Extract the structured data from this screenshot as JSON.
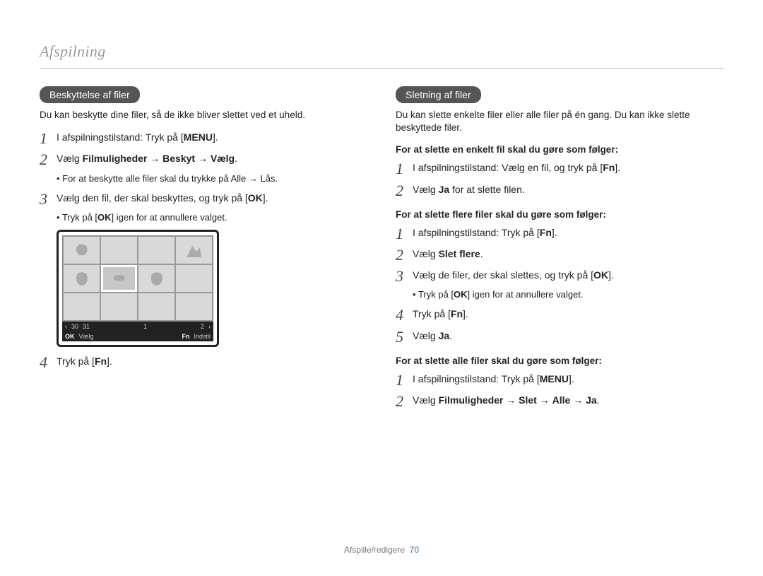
{
  "page": {
    "title": "Afspilning",
    "footer_section": "Afspille/redigere",
    "footer_page": "70"
  },
  "keys": {
    "menu": "MENU",
    "ok": "OK",
    "fn": "Fn"
  },
  "diagram": {
    "dates": {
      "left_arrow": "‹",
      "d1": "30",
      "d2": "31",
      "d3": "1",
      "d4": "2",
      "right_arrow": "›"
    },
    "footer": {
      "ok": "OK",
      "ok_label": "Vælg",
      "fn": "Fn",
      "fn_label": "Indstil"
    }
  },
  "left": {
    "heading": "Beskyttelse af filer",
    "intro": "Du kan beskytte dine filer, så de ikke bliver slettet ved et uheld.",
    "steps": {
      "s1_a": "I afspilningstilstand: Tryk på [",
      "s1_b": "].",
      "s2_a": "Vælg ",
      "s2_b": "Filmuligheder",
      "s2_c": " → ",
      "s2_d": "Beskyt",
      "s2_e": " → ",
      "s2_f": "Vælg",
      "s2_g": ".",
      "s2_bul_a": "For at beskytte alle filer skal du trykke på ",
      "s2_bul_b": "Alle",
      "s2_bul_c": " → ",
      "s2_bul_d": "Lås",
      "s2_bul_e": ".",
      "s3_a": "Vælg den fil, der skal beskyttes, og tryk på [",
      "s3_b": "].",
      "s3_bul_a": "Tryk på [",
      "s3_bul_b": "] igen for at annullere valget.",
      "s4_a": "Tryk på [",
      "s4_b": "]."
    }
  },
  "right": {
    "heading": "Sletning af filer",
    "intro": "Du kan slette enkelte filer eller alle filer på én gang. Du kan ikke slette beskyttede filer.",
    "procA_head": "For at slette en enkelt fil skal du gøre som følger:",
    "procA": {
      "s1_a": "I afspilningstilstand: Vælg en fil, og tryk på [",
      "s1_b": "].",
      "s2_a": "Vælg ",
      "s2_b": "Ja",
      "s2_c": " for at slette filen."
    },
    "procB_head": "For at slette flere filer skal du gøre som følger:",
    "procB": {
      "s1_a": "I afspilningstilstand: Tryk på [",
      "s1_b": "].",
      "s2_a": "Vælg ",
      "s2_b": "Slet flere",
      "s2_c": ".",
      "s3_a": "Vælg de filer, der skal slettes, og tryk på [",
      "s3_b": "].",
      "s3_bul_a": "Tryk på [",
      "s3_bul_b": "] igen for at annullere valget.",
      "s4_a": "Tryk på [",
      "s4_b": "].",
      "s5_a": "Vælg ",
      "s5_b": "Ja",
      "s5_c": "."
    },
    "procC_head": "For at slette alle filer skal du gøre som følger:",
    "procC": {
      "s1_a": "I afspilningstilstand: Tryk på [",
      "s1_b": "].",
      "s2_a": "Vælg ",
      "s2_b": "Filmuligheder",
      "s2_c": " → ",
      "s2_d": "Slet",
      "s2_e": " → ",
      "s2_f": "Alle",
      "s2_g": " → ",
      "s2_h": "Ja",
      "s2_i": "."
    }
  }
}
